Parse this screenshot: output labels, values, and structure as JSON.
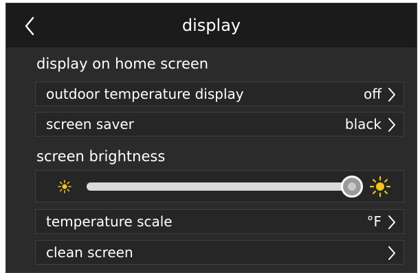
{
  "header": {
    "title": "display",
    "back_icon": "chevron-left-icon"
  },
  "home_screen_section": {
    "label": "display on home screen",
    "rows": [
      {
        "label": "outdoor temperature display",
        "value": "off"
      },
      {
        "label": "screen saver",
        "value": "black"
      }
    ]
  },
  "brightness_section": {
    "label": "screen brightness",
    "level": 1.0,
    "min_icon": "sun-small-icon",
    "max_icon": "sun-large-icon"
  },
  "other_rows": [
    {
      "label": "temperature scale",
      "value": "°F"
    },
    {
      "label": "clean screen",
      "value": ""
    }
  ],
  "colors": {
    "background": "#2b2b2b",
    "header": "#1b1b1b",
    "row": "#262626",
    "sun": "#f5c518",
    "track": "#d9d9d9"
  }
}
